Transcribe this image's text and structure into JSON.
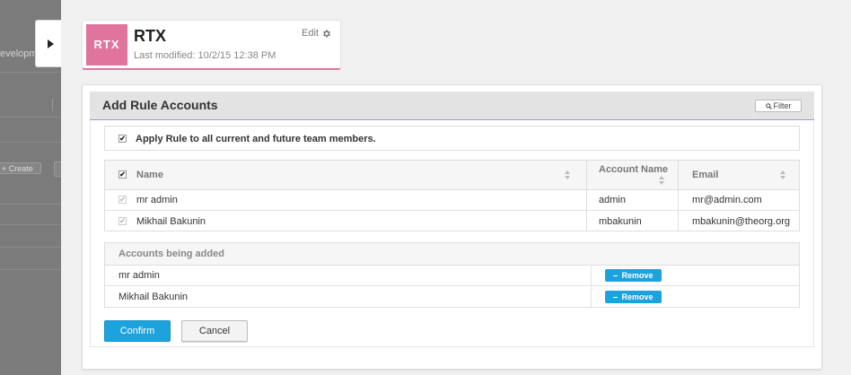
{
  "sidebar": {
    "partial_text": "evelopm",
    "create_label": "+ Create"
  },
  "header": {
    "logo_text": "RTX",
    "title": "RTX",
    "modified": "Last modified: 10/2/15 12:38 PM",
    "edit_label": "Edit"
  },
  "panel": {
    "title": "Add Rule Accounts",
    "filter_label": "Filter",
    "apply_label": "Apply Rule to all current and future team members.",
    "apply_checked": true,
    "users_table": {
      "headers": {
        "name": "Name",
        "account": "Account Name",
        "email": "Email"
      },
      "rows": [
        {
          "name": "mr admin",
          "account": "admin",
          "email": "mr@admin.com",
          "checked": true
        },
        {
          "name": "Mikhail Bakunin",
          "account": "mbakunin",
          "email": "mbakunin@theorg.org",
          "checked": true
        }
      ]
    },
    "added": {
      "header": "Accounts being added",
      "rows": [
        {
          "name": "mr admin",
          "remove_label": "Remove"
        },
        {
          "name": "Mikhail Bakunin",
          "remove_label": "Remove"
        }
      ]
    },
    "confirm_label": "Confirm",
    "cancel_label": "Cancel"
  },
  "colors": {
    "brand_pink": "#e0749d",
    "accent_blue": "#1ca3de",
    "sidebar_gray": "#7b7b7b"
  }
}
